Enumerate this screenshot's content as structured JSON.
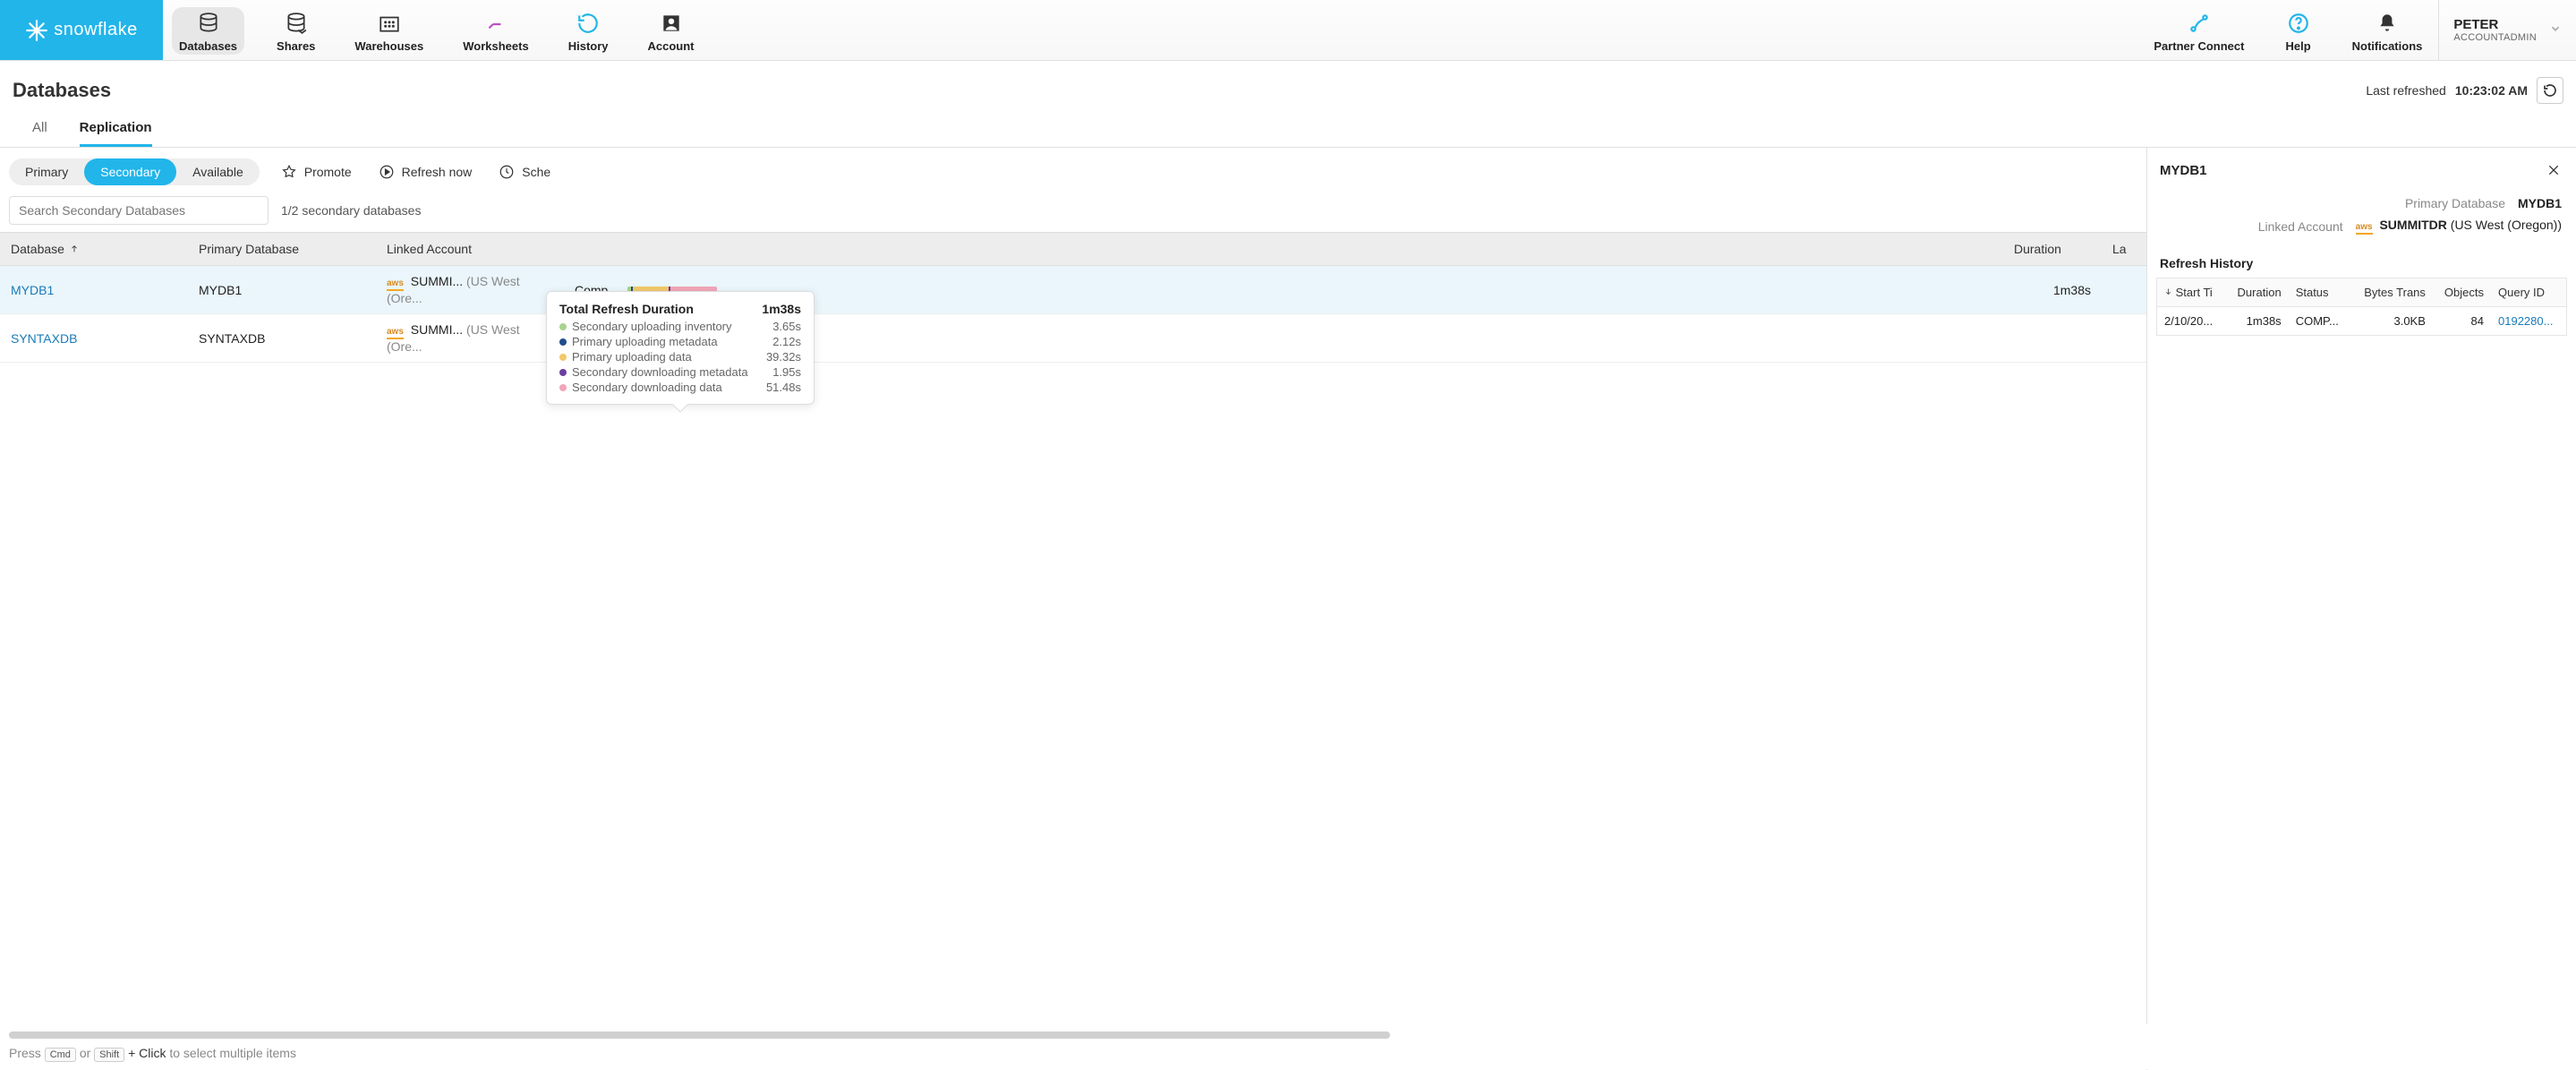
{
  "brand": "snowflake",
  "nav": {
    "items": [
      {
        "label": "Databases",
        "active": true
      },
      {
        "label": "Shares"
      },
      {
        "label": "Warehouses"
      },
      {
        "label": "Worksheets"
      },
      {
        "label": "History"
      },
      {
        "label": "Account"
      }
    ],
    "right": [
      {
        "label": "Partner Connect"
      },
      {
        "label": "Help"
      },
      {
        "label": "Notifications"
      }
    ]
  },
  "user": {
    "name": "PETER",
    "role": "ACCOUNTADMIN"
  },
  "page": {
    "title": "Databases",
    "last_refreshed_label": "Last refreshed",
    "last_refreshed_time": "10:23:02 AM",
    "tabs": [
      {
        "label": "All"
      },
      {
        "label": "Replication",
        "active": true
      }
    ]
  },
  "filters": {
    "segments": [
      {
        "label": "Primary"
      },
      {
        "label": "Secondary",
        "active": true
      },
      {
        "label": "Available"
      }
    ],
    "actions": [
      {
        "label": "Promote",
        "icon": "star"
      },
      {
        "label": "Refresh now",
        "icon": "play"
      },
      {
        "label": "Sche",
        "icon": "clock"
      }
    ],
    "search_placeholder": "Search Secondary Databases",
    "count_text": "1/2 secondary databases"
  },
  "table": {
    "columns": [
      "Database",
      "Primary Database",
      "Linked Account",
      "",
      "Duration",
      "La"
    ],
    "rows": [
      {
        "database": "MYDB1",
        "primary": "MYDB1",
        "account_badge": "aws",
        "account": "SUMMI...",
        "region": "(US West (Ore...",
        "status": "Comp...",
        "duration": "1m38s",
        "selected": true
      },
      {
        "database": "SYNTAXDB",
        "primary": "SYNTAXDB",
        "account_badge": "aws",
        "account": "SUMMI...",
        "region": "(US West (Ore...",
        "status": "",
        "duration": ""
      }
    ]
  },
  "tooltip": {
    "title": "Total Refresh Duration",
    "total": "1m38s",
    "items": [
      {
        "color": "#a7d48c",
        "label": "Secondary uploading inventory",
        "value": "3.65s"
      },
      {
        "color": "#1f4e8c",
        "label": "Primary uploading metadata",
        "value": "2.12s"
      },
      {
        "color": "#f2c96b",
        "label": "Primary uploading data",
        "value": "39.32s"
      },
      {
        "color": "#6b3fa0",
        "label": "Secondary downloading metadata",
        "value": "1.95s"
      },
      {
        "color": "#f2a6b8",
        "label": "Secondary downloading data",
        "value": "51.48s"
      }
    ]
  },
  "footer_hint": {
    "prefix": "Press",
    "k1": "Cmd",
    "mid": "or",
    "k2": "Shift",
    "suffix_bold": "+ Click",
    "suffix": " to select multiple items"
  },
  "detail": {
    "title": "MYDB1",
    "meta": [
      {
        "label": "Primary Database",
        "value": "MYDB1"
      },
      {
        "label": "Linked Account",
        "badge": "aws",
        "value": "SUMMITDR",
        "region": "(US West (Oregon))"
      }
    ],
    "history_title": "Refresh History",
    "history_cols": [
      "Start Ti",
      "Duration",
      "Status",
      "Bytes Trans",
      "Objects",
      "Query ID"
    ],
    "history_rows": [
      {
        "start": "2/10/20...",
        "duration": "1m38s",
        "status": "COMP...",
        "bytes": "3.0KB",
        "objects": "84",
        "query": "0192280..."
      }
    ]
  },
  "colors": {
    "accent": "#21b5ea"
  }
}
